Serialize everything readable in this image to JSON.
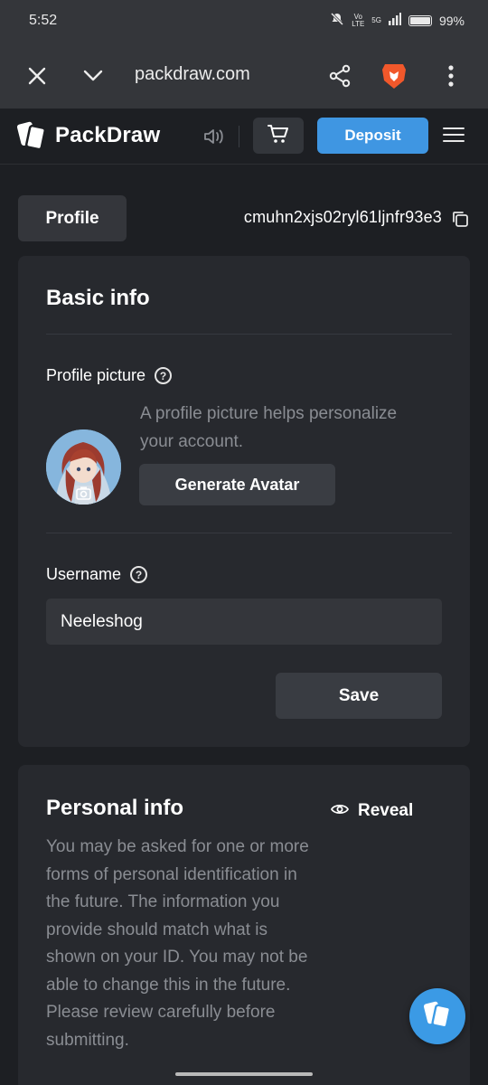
{
  "status_bar": {
    "time": "5:52",
    "network_top": "Vo LTE",
    "network_5g": "5G",
    "battery": "99%"
  },
  "browser": {
    "url": "packdraw.com",
    "icons": [
      "close-icon",
      "chevron-down-icon",
      "share-icon",
      "brave-lion-icon",
      "more-vertical-icon"
    ]
  },
  "site_header": {
    "logo_text": "PackDraw",
    "deposit_label": "Deposit",
    "accent_color": "#3f96e2"
  },
  "profile_tab": {
    "label": "Profile",
    "user_id": "cmuhn2xjs02ryl61ljnfr93e3"
  },
  "basic_info": {
    "title": "Basic info",
    "profile_picture_label": "Profile picture",
    "profile_picture_desc": "A profile picture helps personalize your account.",
    "generate_avatar_label": "Generate Avatar",
    "username_label": "Username",
    "username_value": "Neeleshog",
    "save_label": "Save"
  },
  "personal_info": {
    "title": "Personal info",
    "reveal_label": "Reveal",
    "description": "You may be asked for one or more forms of personal identification in the future. The information you provide should match what is shown on your ID. You may not be able to change this in the future. Please review carefully before submitting."
  }
}
